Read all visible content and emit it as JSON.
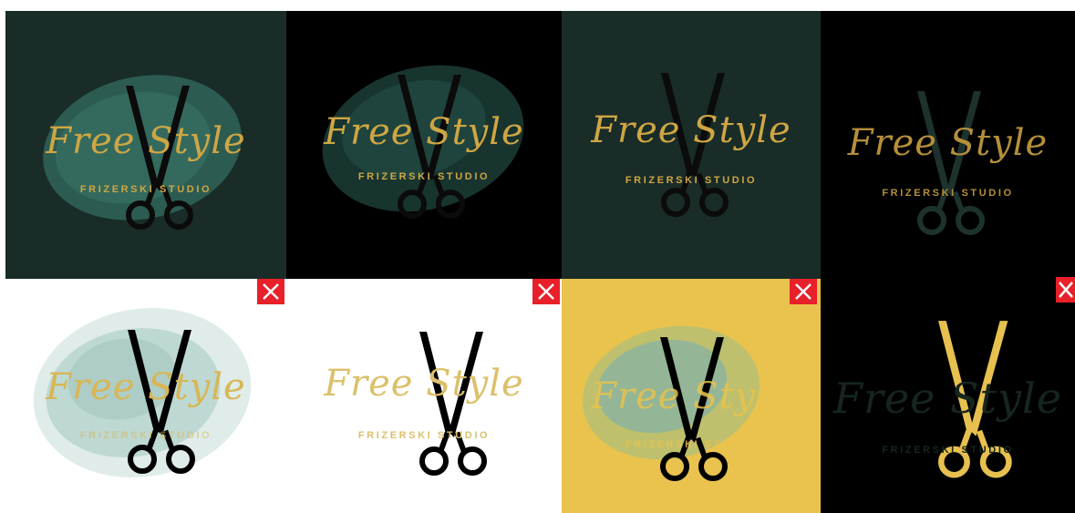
{
  "logo": {
    "script_text": "Free Style",
    "subtitle_text": "FRIZERSKI STUDIO"
  },
  "tiles": [
    {
      "name": "variant-1",
      "background": "#192c28",
      "brush": "#2f6157",
      "text": "#cfa643",
      "scissors": "#0b0b0b"
    },
    {
      "name": "variant-2",
      "background": "#000000",
      "brush": "#1b3a34",
      "text": "#cfa643",
      "scissors": "#0b0b0b"
    },
    {
      "name": "variant-3",
      "background": "#192c28",
      "brush": "",
      "text": "#cfa643",
      "scissors": "#0b0b0b"
    },
    {
      "name": "variant-4",
      "background": "#000000",
      "brush": "",
      "text": "#b58f3a",
      "scissors": "#1d322d"
    },
    {
      "name": "variant-5",
      "background": "#ffffff",
      "brush": "#b9d5cf",
      "text": "#d8b654",
      "scissors": "#000000"
    },
    {
      "name": "variant-6",
      "background": "#ffffff",
      "brush": "",
      "text": "#dcc06a",
      "scissors": "#000000"
    },
    {
      "name": "variant-7",
      "background": "#e9c34d",
      "brush": "#8fb59a",
      "text": "#e9c34d",
      "scissors": "#000000"
    },
    {
      "name": "variant-8",
      "background": "#000000",
      "brush": "",
      "text": "#16261f",
      "scissors": "#e7c04f"
    }
  ],
  "close_button": {
    "icon": "close-icon",
    "color": "#e8202a"
  }
}
